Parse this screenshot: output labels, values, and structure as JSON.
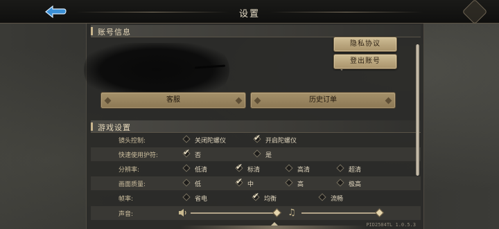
{
  "window": {
    "title": "设置"
  },
  "account": {
    "header": "账号信息",
    "privacy_button": "隐私协议",
    "logout_button": "登出账号",
    "customer_service_button": "客服",
    "order_history_button": "历史订单"
  },
  "game_settings": {
    "header": "游戏设置",
    "rows": [
      {
        "label": "镜头控制:",
        "options": [
          {
            "text": "关闭陀螺仪",
            "checked": false
          },
          {
            "text": "开启陀螺仪",
            "checked": true
          }
        ]
      },
      {
        "label": "快速使用护符:",
        "options": [
          {
            "text": "否",
            "checked": true
          },
          {
            "text": "是",
            "checked": false
          }
        ]
      },
      {
        "label": "分辨率:",
        "options": [
          {
            "text": "低清",
            "checked": false
          },
          {
            "text": "标清",
            "checked": true
          },
          {
            "text": "高清",
            "checked": false
          },
          {
            "text": "超清",
            "checked": false
          }
        ]
      },
      {
        "label": "画面质量:",
        "options": [
          {
            "text": "低",
            "checked": false
          },
          {
            "text": "中",
            "checked": true
          },
          {
            "text": "高",
            "checked": false
          },
          {
            "text": "极高",
            "checked": false
          }
        ]
      },
      {
        "label": "帧率:",
        "options": [
          {
            "text": "省电",
            "checked": false
          },
          {
            "text": "均衡",
            "checked": true
          },
          {
            "text": "流畅",
            "checked": false
          }
        ]
      }
    ],
    "sound": {
      "label": "声音:",
      "sfx_level": 1.0,
      "music_level": 1.0
    }
  },
  "version_text": "PID2584TL 1.0.5.3",
  "icons": {
    "back": "back-arrow-icon",
    "search": "search-icon",
    "speaker": "speaker-icon",
    "music": "music-note-icon",
    "check": "checkmark-icon"
  },
  "colors": {
    "accent_gold": "#c9b68c",
    "back_button_blue": "#3a8fd6",
    "panel_bg": "#2a2a28"
  }
}
